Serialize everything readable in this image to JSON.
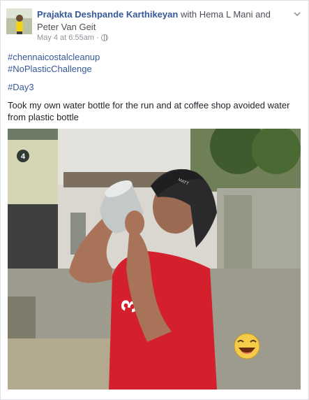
{
  "post": {
    "author": "Prajakta Deshpande Karthikeyan",
    "with_text": "with",
    "tagged": [
      "Hema L Mani",
      "Peter Van Geit"
    ],
    "and_text": "and",
    "timestamp": "May 4 at 6:55am",
    "separator": "·",
    "privacy_icon": "globe-icon",
    "menu_icon": "chevron-down-icon",
    "hashtags": [
      "#chennaicostalcleanup",
      "#NoPlasticChallenge"
    ],
    "day_tag": "#Day3",
    "caption": "Took my own water bottle for the run and at coffee shop avoided water from plastic bottle",
    "photo": {
      "house_number": "4",
      "cap_text": "MATT",
      "shirt_text": "3"
    }
  },
  "colors": {
    "link": "#365899",
    "text": "#1d2129",
    "muted": "#90949c",
    "shirt": "#d4202c"
  }
}
